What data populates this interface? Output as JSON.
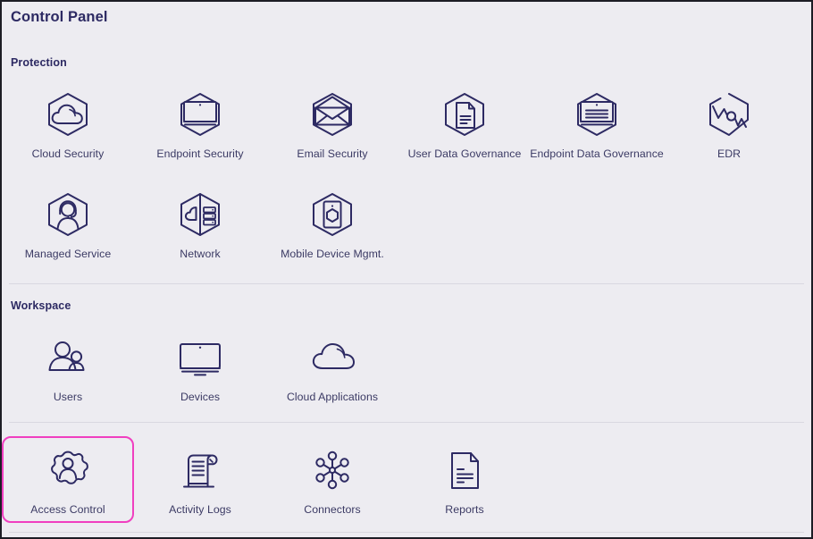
{
  "window": {
    "title": "Control Panel"
  },
  "theme": {
    "background": "#edecf1",
    "icon_stroke": "#2d2a63",
    "title_color": "#2d2a63",
    "label_color": "#3b3a64",
    "divider": "#d9d8e0",
    "selection_accent": "#f03fc0"
  },
  "sections": [
    {
      "title": "Protection",
      "rows": [
        [
          {
            "label": "Cloud Security",
            "icon": "cloud-security-icon",
            "selected": false
          },
          {
            "label": "Endpoint Security",
            "icon": "endpoint-security-icon",
            "selected": false
          },
          {
            "label": "Email Security",
            "icon": "email-security-icon",
            "selected": false
          },
          {
            "label": "User Data Governance",
            "icon": "user-data-governance-icon",
            "selected": false
          },
          {
            "label": "Endpoint Data Governance",
            "icon": "endpoint-data-governance-icon",
            "selected": false
          },
          {
            "label": "EDR",
            "icon": "edr-icon",
            "selected": false
          }
        ],
        [
          {
            "label": "Managed Service",
            "icon": "managed-service-icon",
            "selected": false
          },
          {
            "label": "Network",
            "icon": "network-icon",
            "selected": false
          },
          {
            "label": "Mobile Device Mgmt.",
            "icon": "mobile-device-mgmt-icon",
            "selected": false
          }
        ]
      ]
    },
    {
      "title": "Workspace",
      "rows": [
        [
          {
            "label": "Users",
            "icon": "users-icon",
            "selected": false
          },
          {
            "label": "Devices",
            "icon": "devices-icon",
            "selected": false
          },
          {
            "label": "Cloud Applications",
            "icon": "cloud-applications-icon",
            "selected": false
          }
        ],
        [
          {
            "label": "Access Control",
            "icon": "access-control-icon",
            "selected": true
          },
          {
            "label": "Activity Logs",
            "icon": "activity-logs-icon",
            "selected": false
          },
          {
            "label": "Connectors",
            "icon": "connectors-icon",
            "selected": false
          },
          {
            "label": "Reports",
            "icon": "reports-icon",
            "selected": false
          }
        ]
      ]
    }
  ]
}
